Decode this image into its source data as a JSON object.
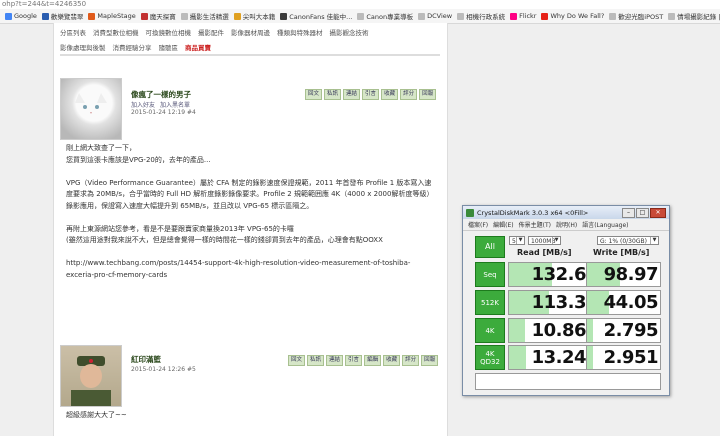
{
  "url_fragment": "ohp?t=244&t=4246350",
  "bookmarks": [
    {
      "label": "Google",
      "icon": "google-icon",
      "color": "#4285f4"
    },
    {
      "label": "歡樂覽翡翠",
      "icon": "bookmark-icon",
      "color": "#2a5db0"
    },
    {
      "label": "MapleStage",
      "icon": "maple-icon",
      "color": "#e05a1a"
    },
    {
      "label": "魔天探寶",
      "icon": "bookmark-icon",
      "color": "#c23030"
    },
    {
      "label": "攝影生活精選",
      "icon": "page-icon",
      "color": "#bbbbbb"
    },
    {
      "label": "尖叫大本籍",
      "icon": "bookmark-icon",
      "color": "#e0a020"
    },
    {
      "label": "CanonFans 佳能中...",
      "icon": "bookmark-icon",
      "color": "#3a3a3a"
    },
    {
      "label": "Canon專業導板",
      "icon": "page-icon",
      "color": "#bbbbbb"
    },
    {
      "label": "DCView",
      "icon": "page-icon",
      "color": "#bbbbbb"
    },
    {
      "label": "相機行政系統",
      "icon": "page-icon",
      "color": "#bbbbbb"
    },
    {
      "label": "Flickr",
      "icon": "flickr-icon",
      "color": "#ff0084"
    },
    {
      "label": "Why Do We Fall?",
      "icon": "youtube-icon",
      "color": "#e62117"
    },
    {
      "label": "歡迎光臨iPOST",
      "icon": "page-icon",
      "color": "#bbbbbb"
    },
    {
      "label": "情場攝影紀錄 | 寶莉",
      "icon": "page-icon",
      "color": "#bbbbbb"
    }
  ],
  "forum_nav": {
    "row1": [
      "分區列表",
      "消費型數位相機",
      "可換鏡數位相機",
      "攝影配件",
      "影像器材周邊",
      "種類與特殊器材",
      "攝影觀念技術"
    ],
    "row2": [
      "影像處理與後製",
      "消費經驗分享",
      "隨聽區"
    ],
    "hot": "商品買賣"
  },
  "posts": [
    {
      "username": "像瘋了一樣的男子",
      "user_links": [
        "加入好友",
        "加入黑名單"
      ],
      "date": "2015-01-24 12:19",
      "post_no": "#4",
      "buttons": [
        "回文",
        "私訊",
        "連結",
        "引言",
        "收藏",
        "評分",
        "回報"
      ],
      "paragraphs": [
        "剛上網大致查了一下，",
        "您買到這張卡應該是VPG-20的，去年的產品...",
        "",
        "VPG（Video Performance Guarantee）屬於 CFA 制定的錄影速度保證規範，2011 年首發布 Profile 1 版本寫入速度要求為 20MB/s，合乎當時的 Full HD 解析度錄影錄像要求。Profile 2 規範範囲應 4K（4000 x 2000解析度等級）錄影應用，保證寫入速度大幅提升到 65MB/s，並且改以 VPG-65 標示區隔之。",
        "",
        "再附上東源網站您參考，看是不是要跟賣家商量換2013年 VPG-65的卡囉",
        "(雖然這用途對我來說不大，但是總會覺得一樣的時間花一樣的錢卻買到去年的產品，心理會有點OOXX",
        "",
        "http://www.techbang.com/posts/14454-support-4k-high-resolution-video-measurement-of-toshiba-exceria-pro-cf-memory-cards"
      ]
    },
    {
      "username": "紅印滿籃",
      "date": "2015-01-24 12:26",
      "post_no": "#5",
      "buttons": [
        "回文",
        "私訊",
        "連結",
        "引言",
        "編輯",
        "收藏",
        "評分",
        "回報"
      ],
      "paragraphs": [
        "超級感謝大大了~~"
      ]
    }
  ],
  "cdm": {
    "title": "CrystalDiskMark 3.0.3 x64 <0Fill>",
    "menu": [
      "檔案(F)",
      "編輯(E)",
      "佈景主題(T)",
      "說明(H)",
      "語言(Language)"
    ],
    "all_label": "All",
    "count": "5",
    "size": "1000MB",
    "drive": "G: 1% (0/30GB)",
    "read_header": "Read [MB/s]",
    "write_header": "Write [MB/s]",
    "rows": [
      {
        "label": "Seq",
        "sublabel": "",
        "read": "132.6",
        "write": "98.97",
        "read_level": 0.55,
        "write_level": 0.45
      },
      {
        "label": "512K",
        "sublabel": "",
        "read": "113.3",
        "write": "44.05",
        "read_level": 0.5,
        "write_level": 0.3
      },
      {
        "label": "4K",
        "sublabel": "",
        "read": "10.86",
        "write": "2.795",
        "read_level": 0.2,
        "write_level": 0.08
      },
      {
        "label": "4K",
        "sublabel": "QD32",
        "read": "13.24",
        "write": "2.951",
        "read_level": 0.22,
        "write_level": 0.08
      }
    ],
    "colors": {
      "accent": "#3cab3c",
      "bar": "#b4e6b4"
    }
  }
}
